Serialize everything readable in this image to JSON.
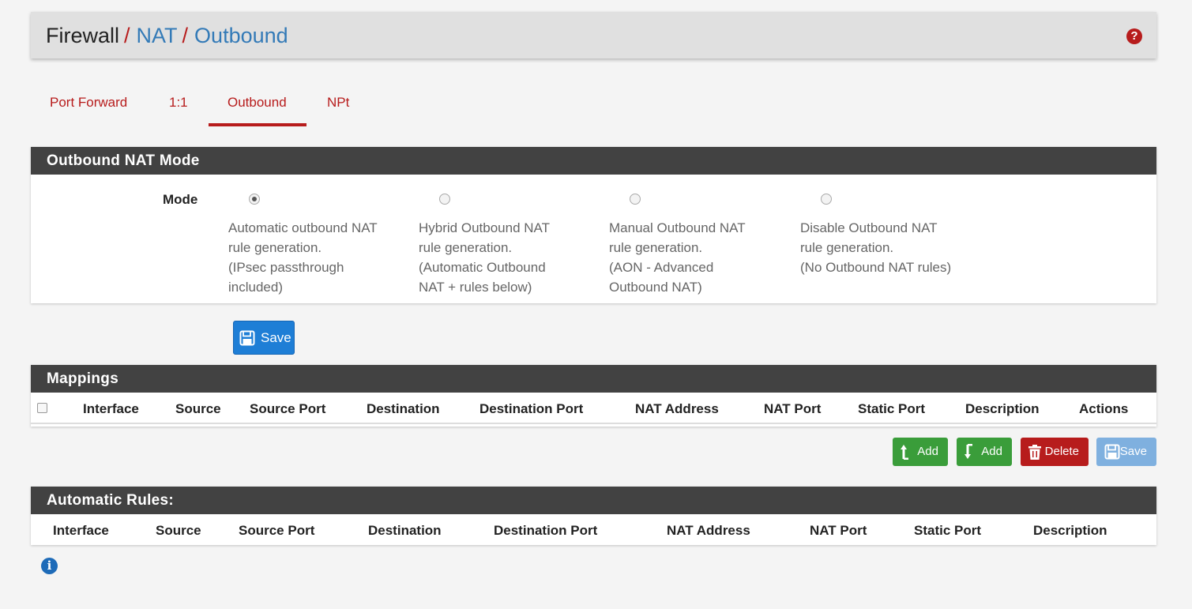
{
  "breadcrumb": {
    "home": "Firewall",
    "separator": "/",
    "level2": "NAT",
    "level3": "Outbound"
  },
  "help_icon": "question-circle-icon",
  "tabs": [
    {
      "label": "Port Forward",
      "active": false
    },
    {
      "label": "1:1",
      "active": false
    },
    {
      "label": "Outbound",
      "active": true
    },
    {
      "label": "NPt",
      "active": false
    }
  ],
  "mode_panel": {
    "title": "Outbound NAT Mode",
    "field_label": "Mode",
    "options": [
      {
        "text": "Automatic outbound NAT\nrule generation.\n(IPsec passthrough\nincluded)",
        "selected": true
      },
      {
        "text": "Hybrid Outbound NAT\nrule generation.\n(Automatic Outbound\nNAT + rules below)",
        "selected": false
      },
      {
        "text": "Manual Outbound NAT\nrule generation.\n(AON - Advanced\nOutbound NAT)",
        "selected": false
      },
      {
        "text": "Disable Outbound NAT\nrule generation.\n(No Outbound NAT rules)",
        "selected": false
      }
    ],
    "save_label": "Save"
  },
  "mappings": {
    "title": "Mappings",
    "columns": [
      "Interface",
      "Source",
      "Source Port",
      "Destination",
      "Destination Port",
      "NAT Address",
      "NAT Port",
      "Static Port",
      "Description",
      "Actions"
    ],
    "rows": [],
    "buttons": {
      "add_top": "Add",
      "add_bottom": "Add",
      "delete": "Delete",
      "save": "Save"
    }
  },
  "automatic_rules": {
    "title": "Automatic Rules:",
    "columns": [
      "Interface",
      "Source",
      "Source Port",
      "Destination",
      "Destination Port",
      "NAT Address",
      "NAT Port",
      "Static Port",
      "Description"
    ],
    "rows": []
  },
  "colors": {
    "accent": "#b71c1c",
    "link": "#337ab7",
    "panel_heading": "#424242",
    "primary": "#1e7ed6",
    "success": "#3a9d3a",
    "danger": "#b71c1c"
  }
}
